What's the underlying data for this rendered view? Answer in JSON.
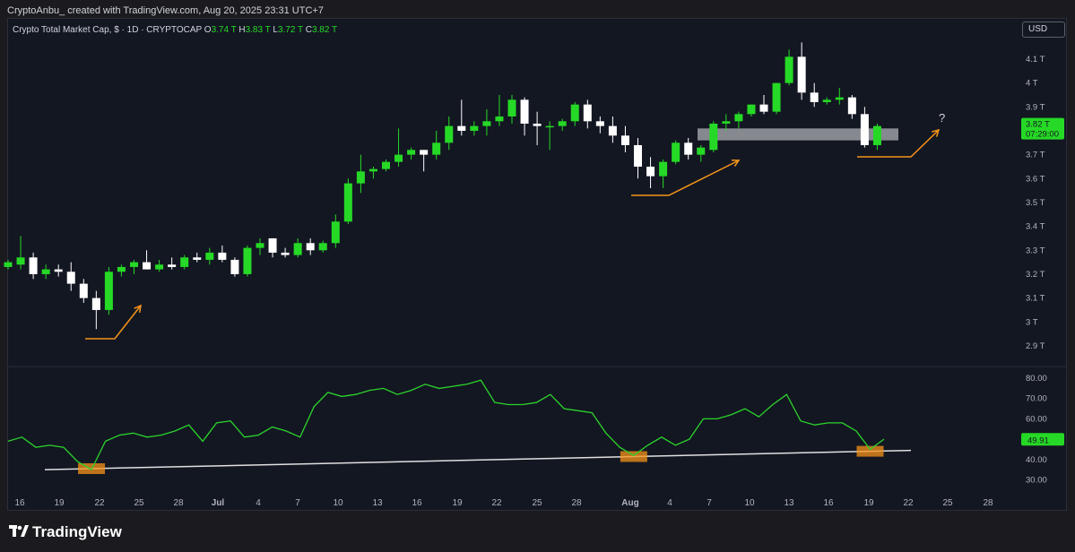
{
  "header": {
    "credit": "CryptoAnbu_ created with TradingView.com, Aug 20, 2025 23:31 UTC+7"
  },
  "legend": {
    "title": "Crypto Total Market Cap, $ · 1D · CRYPTOCAP",
    "o_label": "O",
    "o_value": "3.74 T",
    "h_label": "H",
    "h_value": "3.83 T",
    "l_label": "L",
    "l_value": "3.72 T",
    "c_label": "C",
    "c_value": "3.82 T"
  },
  "currency": "USD",
  "colors": {
    "up": "#26d926",
    "down": "#ffffff",
    "rsi": "#2bd42b",
    "annotation": "#f7931a",
    "background": "#131722",
    "zone": "#9b9ea3"
  },
  "chart_data": [
    {
      "type": "candlestick",
      "title": "Crypto Total Market Cap, $ · 1D · CRYPTOCAP",
      "unit": "T",
      "ylim": [
        2.85,
        4.2
      ],
      "price_ticks": [
        "4.1 T",
        "4 T",
        "3.9 T",
        "3.8 T",
        "3.7 T",
        "3.6 T",
        "3.5 T",
        "3.4 T",
        "3.3 T",
        "3.2 T",
        "3.1 T",
        "3 T",
        "2.9 T"
      ],
      "last_price_label": "3.82 T",
      "countdown_label": "07:29:00",
      "x_ticks": [
        "16",
        "19",
        "22",
        "25",
        "28",
        "Jul",
        "4",
        "7",
        "10",
        "13",
        "16",
        "19",
        "22",
        "25",
        "28",
        "Aug",
        "4",
        "7",
        "10",
        "13",
        "16",
        "19",
        "22",
        "25",
        "28"
      ],
      "candles": [
        {
          "o": 3.23,
          "h": 3.26,
          "l": 3.22,
          "c": 3.25
        },
        {
          "o": 3.24,
          "h": 3.36,
          "l": 3.22,
          "c": 3.27
        },
        {
          "o": 3.27,
          "h": 3.29,
          "l": 3.18,
          "c": 3.2
        },
        {
          "o": 3.2,
          "h": 3.24,
          "l": 3.18,
          "c": 3.22
        },
        {
          "o": 3.22,
          "h": 3.24,
          "l": 3.19,
          "c": 3.21
        },
        {
          "o": 3.21,
          "h": 3.25,
          "l": 3.13,
          "c": 3.16
        },
        {
          "o": 3.16,
          "h": 3.18,
          "l": 3.08,
          "c": 3.1
        },
        {
          "o": 3.1,
          "h": 3.13,
          "l": 2.97,
          "c": 3.05
        },
        {
          "o": 3.05,
          "h": 3.23,
          "l": 3.03,
          "c": 3.21
        },
        {
          "o": 3.21,
          "h": 3.24,
          "l": 3.19,
          "c": 3.23
        },
        {
          "o": 3.23,
          "h": 3.26,
          "l": 3.2,
          "c": 3.25
        },
        {
          "o": 3.25,
          "h": 3.3,
          "l": 3.22,
          "c": 3.22
        },
        {
          "o": 3.22,
          "h": 3.26,
          "l": 3.21,
          "c": 3.24
        },
        {
          "o": 3.24,
          "h": 3.27,
          "l": 3.22,
          "c": 3.23
        },
        {
          "o": 3.23,
          "h": 3.28,
          "l": 3.22,
          "c": 3.27
        },
        {
          "o": 3.27,
          "h": 3.29,
          "l": 3.25,
          "c": 3.26
        },
        {
          "o": 3.26,
          "h": 3.31,
          "l": 3.24,
          "c": 3.29
        },
        {
          "o": 3.29,
          "h": 3.32,
          "l": 3.25,
          "c": 3.26
        },
        {
          "o": 3.26,
          "h": 3.27,
          "l": 3.19,
          "c": 3.2
        },
        {
          "o": 3.2,
          "h": 3.32,
          "l": 3.19,
          "c": 3.31
        },
        {
          "o": 3.31,
          "h": 3.35,
          "l": 3.28,
          "c": 3.33
        },
        {
          "o": 3.35,
          "h": 3.35,
          "l": 3.27,
          "c": 3.29
        },
        {
          "o": 3.29,
          "h": 3.31,
          "l": 3.27,
          "c": 3.28
        },
        {
          "o": 3.28,
          "h": 3.35,
          "l": 3.27,
          "c": 3.33
        },
        {
          "o": 3.33,
          "h": 3.35,
          "l": 3.28,
          "c": 3.3
        },
        {
          "o": 3.3,
          "h": 3.34,
          "l": 3.29,
          "c": 3.33
        },
        {
          "o": 3.33,
          "h": 3.45,
          "l": 3.31,
          "c": 3.42
        },
        {
          "o": 3.42,
          "h": 3.6,
          "l": 3.41,
          "c": 3.58
        },
        {
          "o": 3.58,
          "h": 3.7,
          "l": 3.54,
          "c": 3.63
        },
        {
          "o": 3.63,
          "h": 3.65,
          "l": 3.6,
          "c": 3.64
        },
        {
          "o": 3.64,
          "h": 3.68,
          "l": 3.63,
          "c": 3.67
        },
        {
          "o": 3.67,
          "h": 3.81,
          "l": 3.65,
          "c": 3.7
        },
        {
          "o": 3.7,
          "h": 3.73,
          "l": 3.68,
          "c": 3.72
        },
        {
          "o": 3.72,
          "h": 3.72,
          "l": 3.63,
          "c": 3.7
        },
        {
          "o": 3.7,
          "h": 3.8,
          "l": 3.68,
          "c": 3.75
        },
        {
          "o": 3.75,
          "h": 3.86,
          "l": 3.72,
          "c": 3.82
        },
        {
          "o": 3.82,
          "h": 3.93,
          "l": 3.78,
          "c": 3.8
        },
        {
          "o": 3.8,
          "h": 3.84,
          "l": 3.78,
          "c": 3.82
        },
        {
          "o": 3.82,
          "h": 3.89,
          "l": 3.78,
          "c": 3.84
        },
        {
          "o": 3.84,
          "h": 3.95,
          "l": 3.82,
          "c": 3.86
        },
        {
          "o": 3.86,
          "h": 3.95,
          "l": 3.83,
          "c": 3.93
        },
        {
          "o": 3.93,
          "h": 3.94,
          "l": 3.78,
          "c": 3.83
        },
        {
          "o": 3.83,
          "h": 3.88,
          "l": 3.74,
          "c": 3.82
        },
        {
          "o": 3.82,
          "h": 3.84,
          "l": 3.72,
          "c": 3.82
        },
        {
          "o": 3.82,
          "h": 3.85,
          "l": 3.8,
          "c": 3.84
        },
        {
          "o": 3.84,
          "h": 3.92,
          "l": 3.82,
          "c": 3.91
        },
        {
          "o": 3.91,
          "h": 3.93,
          "l": 3.81,
          "c": 3.84
        },
        {
          "o": 3.84,
          "h": 3.86,
          "l": 3.79,
          "c": 3.82
        },
        {
          "o": 3.82,
          "h": 3.86,
          "l": 3.75,
          "c": 3.78
        },
        {
          "o": 3.78,
          "h": 3.82,
          "l": 3.71,
          "c": 3.74
        },
        {
          "o": 3.74,
          "h": 3.77,
          "l": 3.6,
          "c": 3.65
        },
        {
          "o": 3.65,
          "h": 3.69,
          "l": 3.56,
          "c": 3.61
        },
        {
          "o": 3.61,
          "h": 3.68,
          "l": 3.56,
          "c": 3.67
        },
        {
          "o": 3.67,
          "h": 3.76,
          "l": 3.66,
          "c": 3.75
        },
        {
          "o": 3.75,
          "h": 3.77,
          "l": 3.68,
          "c": 3.7
        },
        {
          "o": 3.7,
          "h": 3.74,
          "l": 3.67,
          "c": 3.73
        },
        {
          "o": 3.72,
          "h": 3.84,
          "l": 3.71,
          "c": 3.83
        },
        {
          "o": 3.83,
          "h": 3.87,
          "l": 3.8,
          "c": 3.84
        },
        {
          "o": 3.84,
          "h": 3.88,
          "l": 3.81,
          "c": 3.87
        },
        {
          "o": 3.87,
          "h": 3.91,
          "l": 3.86,
          "c": 3.91
        },
        {
          "o": 3.91,
          "h": 3.95,
          "l": 3.87,
          "c": 3.88
        },
        {
          "o": 3.88,
          "h": 4.0,
          "l": 3.87,
          "c": 4.0
        },
        {
          "o": 4.0,
          "h": 4.14,
          "l": 3.99,
          "c": 4.11
        },
        {
          "o": 4.11,
          "h": 4.17,
          "l": 3.93,
          "c": 3.96
        },
        {
          "o": 3.96,
          "h": 4.0,
          "l": 3.9,
          "c": 3.92
        },
        {
          "o": 3.92,
          "h": 3.94,
          "l": 3.91,
          "c": 3.93
        },
        {
          "o": 3.93,
          "h": 3.98,
          "l": 3.91,
          "c": 3.94
        },
        {
          "o": 3.94,
          "h": 3.95,
          "l": 3.85,
          "c": 3.87
        },
        {
          "o": 3.87,
          "h": 3.9,
          "l": 3.73,
          "c": 3.74
        },
        {
          "o": 3.74,
          "h": 3.83,
          "l": 3.72,
          "c": 3.82
        }
      ],
      "zone": {
        "from": 3.76,
        "to": 3.81
      },
      "annotation": "?"
    },
    {
      "type": "line",
      "ylim": [
        25,
        85
      ],
      "rsi_ticks": [
        "80.00",
        "70.00",
        "60.00",
        "50.00",
        "40.00",
        "30.00"
      ],
      "last_value_label": "49.91",
      "series": [
        {
          "values": [
            49,
            51,
            46,
            47,
            46,
            39,
            35,
            49,
            52,
            53,
            51,
            52,
            54,
            57,
            49,
            58,
            59,
            51,
            52,
            56,
            54,
            51,
            66,
            73,
            71,
            72,
            74,
            75,
            72,
            74,
            77,
            75,
            76,
            77,
            79,
            68,
            67,
            67,
            68,
            72,
            65,
            64,
            63,
            53,
            46,
            42,
            47,
            51,
            47,
            50,
            60,
            60,
            62,
            65,
            61,
            67,
            72,
            59,
            57,
            58,
            58,
            54,
            45,
            50
          ]
        }
      ],
      "trendline": {
        "from": 35,
        "to": 44.5
      },
      "markers": [
        6,
        45,
        62
      ]
    }
  ]
}
